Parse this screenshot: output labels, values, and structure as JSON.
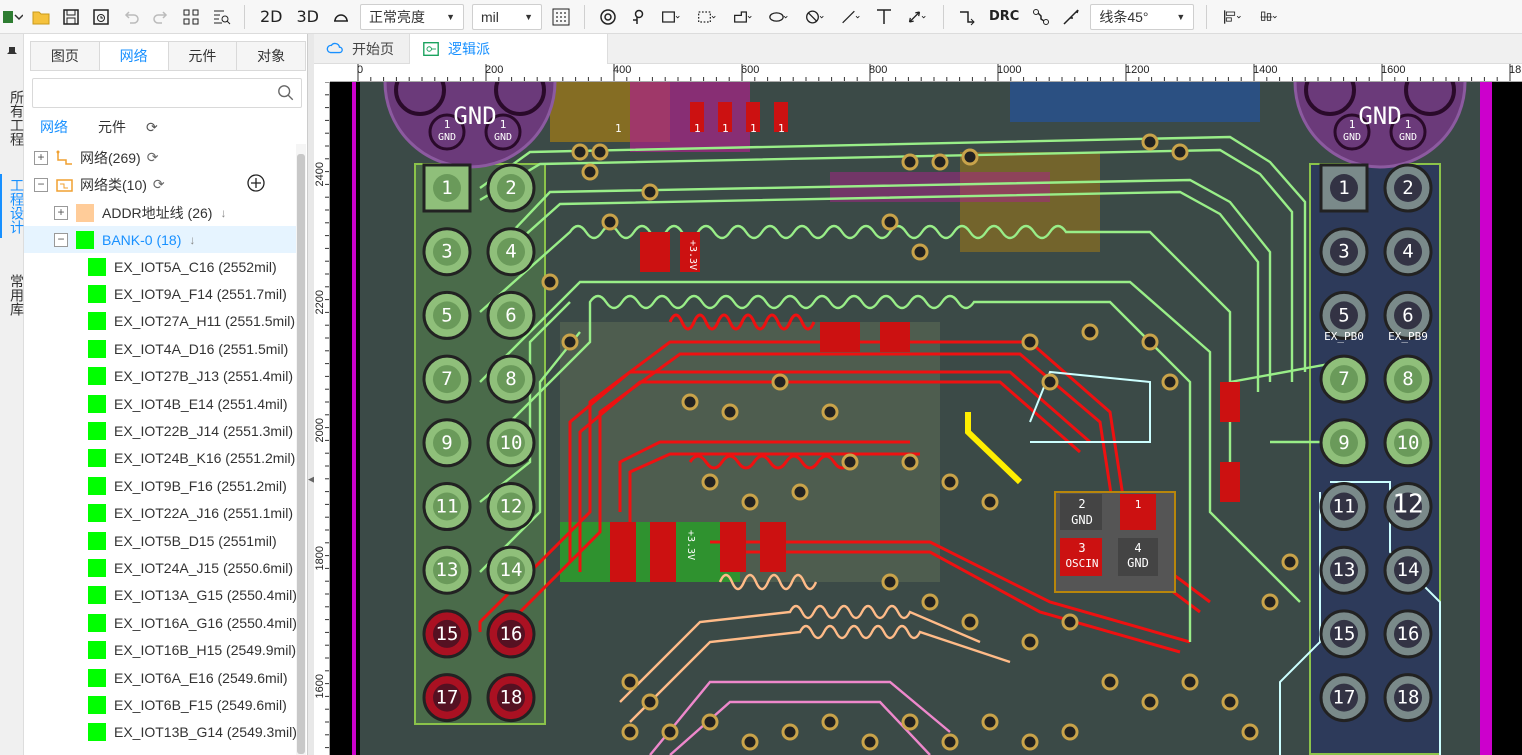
{
  "toolbar": {
    "view_2d": "2D",
    "view_3d": "3D",
    "brightness": "正常亮度",
    "unit": "mil",
    "drc": "DRC",
    "route_mode": "线条45°"
  },
  "left_strip": {
    "tab_all_projects": "所有工程",
    "tab_project_design": "工程设计",
    "tab_common_lib": "常用库"
  },
  "panel": {
    "tabs": [
      {
        "label": "图页"
      },
      {
        "label": "网络"
      },
      {
        "label": "元件"
      },
      {
        "label": "对象"
      }
    ],
    "search_placeholder": "",
    "subtabs": [
      {
        "label": "网络"
      },
      {
        "label": "元件"
      }
    ],
    "tree": {
      "nets": "网络(269)",
      "netclasses": "网络类(10)",
      "addr": "ADDR地址线 (26)",
      "bank0": "BANK-0 (18)",
      "items": [
        "EX_IOT5A_C16 (2552mil)",
        "EX_IOT9A_F14 (2551.7mil)",
        "EX_IOT27A_H11 (2551.5mil)",
        "EX_IOT4A_D16 (2551.5mil)",
        "EX_IOT27B_J13 (2551.4mil)",
        "EX_IOT4B_E14 (2551.4mil)",
        "EX_IOT22B_J14 (2551.3mil)",
        "EX_IOT24B_K16 (2551.2mil)",
        "EX_IOT9B_F16 (2551.2mil)",
        "EX_IOT22A_J16 (2551.1mil)",
        "EX_IOT5B_D15 (2551mil)",
        "EX_IOT24A_J15 (2550.6mil)",
        "EX_IOT13A_G15 (2550.4mil)",
        "EX_IOT16A_G16 (2550.4mil)",
        "EX_IOT16B_H15 (2549.9mil)",
        "EX_IOT6A_E16 (2549.6mil)",
        "EX_IOT6B_F15 (2549.6mil)",
        "EX_IOT13B_G14 (2549.3mil)"
      ]
    }
  },
  "doc_tabs": {
    "start": "开始页",
    "logic": "逻辑派"
  },
  "ruler": {
    "h": [
      "0",
      "200",
      "400",
      "600",
      "800",
      "1000",
      "1200",
      "1400",
      "1600",
      "18"
    ],
    "v": [
      "2400",
      "2200",
      "2000",
      "1800",
      "1600"
    ]
  },
  "board": {
    "gnd_left": "GND",
    "gnd_right": "GND",
    "gnd_small": "GND",
    "pin_one": "1",
    "left_header": [
      "1",
      "2",
      "3",
      "4",
      "5",
      "6",
      "7",
      "8",
      "9",
      "10",
      "11",
      "12",
      "13",
      "14",
      "15",
      "16",
      "17",
      "18"
    ],
    "right_header": [
      "1",
      "2",
      "3",
      "4",
      "5",
      "6",
      "7",
      "8",
      "9",
      "10",
      "11",
      "12",
      "13",
      "14",
      "15",
      "16",
      "17",
      "18"
    ],
    "ex_pb0": "EX_PB0",
    "ex_pb9": "EX_PB9",
    "osc_pin2": "2",
    "osc_gnd_a": "GND",
    "osc_pin3": "3",
    "osc_oscin": "OSCIN",
    "osc_pin4": "4",
    "osc_gnd_b": "GND",
    "label_3v3": "+3.3V",
    "label_3v": "+3.3V"
  },
  "colors": {
    "accent": "#1890ff",
    "net_green": "#00ff00",
    "addr_swatch": "#ffcc99"
  }
}
